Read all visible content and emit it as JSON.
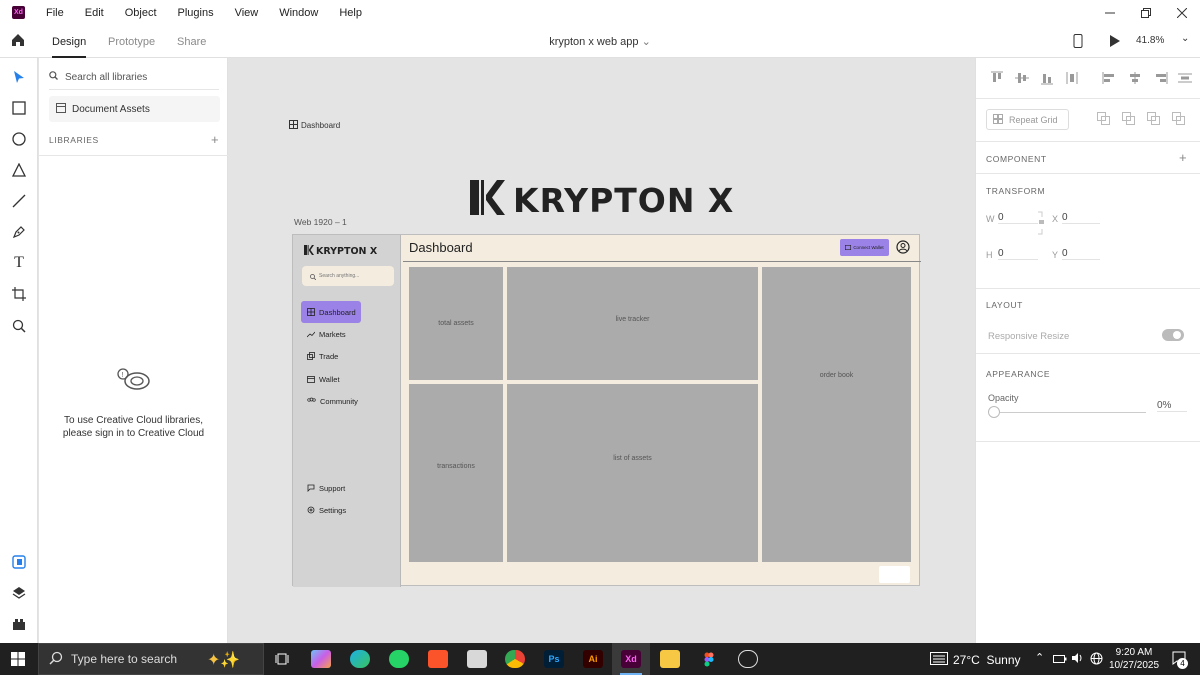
{
  "app": {
    "logo": "Xd"
  },
  "menu": [
    "File",
    "Edit",
    "Object",
    "Plugins",
    "View",
    "Window",
    "Help"
  ],
  "tabs": [
    {
      "label": "Design",
      "active": true
    },
    {
      "label": "Prototype",
      "active": false
    },
    {
      "label": "Share",
      "active": false
    }
  ],
  "document": {
    "title": "krypton x web app"
  },
  "zoom": "41.8%",
  "library": {
    "search_placeholder": "Search all libraries",
    "document_assets": "Document Assets",
    "libraries_label": "LIBRARIES",
    "signin_line1": "To use Creative Cloud libraries,",
    "signin_line2": "please sign in to Creative Cloud"
  },
  "canvas": {
    "dashboard_label": "Dashboard",
    "logo_text": "KRYPTON X",
    "artboard_label": "Web 1920 – 1"
  },
  "artboard": {
    "logo_text": "KRYPTON X",
    "title": "Dashboard",
    "search_placeholder": "Search anything...",
    "connect_wallet": "Connect Wallet",
    "nav": [
      "Dashboard",
      "Markets",
      "Trade",
      "Wallet",
      "Community"
    ],
    "nav_bottom": [
      "Support",
      "Settings"
    ],
    "cards": {
      "total_assets": "total assets",
      "live_tracker": "live tracker",
      "order_book": "order book",
      "transactions": "transactions",
      "list_of_assets": "list of assets"
    },
    "accent": "#9b82e6"
  },
  "props": {
    "repeat_grid": "Repeat Grid",
    "component": "COMPONENT",
    "transform": "TRANSFORM",
    "w_label": "W",
    "w_value": "0",
    "x_label": "X",
    "x_value": "0",
    "h_label": "H",
    "h_value": "0",
    "y_label": "Y",
    "y_value": "0",
    "layout": "LAYOUT",
    "responsive_resize": "Responsive Resize",
    "appearance": "APPEARANCE",
    "opacity_label": "Opacity",
    "opacity_value": "0%"
  },
  "taskbar": {
    "search_placeholder": "Type here to search",
    "weather": "27°C  Sunny",
    "time": "9:20 AM",
    "date": "10/27/2025",
    "notifications": "4",
    "apps": [
      "task-view",
      "copilot",
      "edge",
      "whatsapp",
      "brave",
      "photo-app",
      "chrome",
      "photoshop",
      "illustrator",
      "xd",
      "file-explorer",
      "figma",
      "obs"
    ],
    "app_labels": {
      "ps": "Ps",
      "ai": "Ai",
      "xd": "Xd"
    }
  }
}
